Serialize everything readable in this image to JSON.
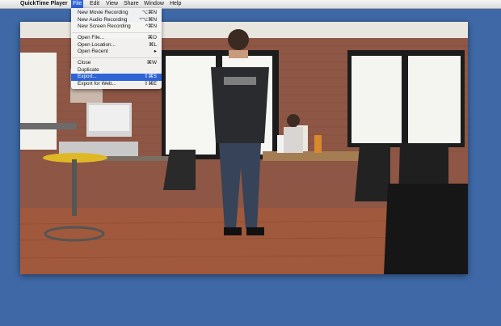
{
  "menubar": {
    "apple": "",
    "app_name": "QuickTime Player",
    "items": [
      "File",
      "Edit",
      "View",
      "Share",
      "Window",
      "Help"
    ]
  },
  "file_menu": {
    "items": [
      {
        "label": "New Movie Recording",
        "shortcut": "⌥⌘N"
      },
      {
        "label": "New Audio Recording",
        "shortcut": "^⌥⌘N"
      },
      {
        "label": "New Screen Recording",
        "shortcut": "^⌘N"
      },
      {
        "label": "Open File...",
        "shortcut": "⌘O"
      },
      {
        "label": "Open Location...",
        "shortcut": "⌘L"
      },
      {
        "label": "Open Recent",
        "shortcut": "▸"
      },
      {
        "label": "Close",
        "shortcut": "⌘W"
      },
      {
        "label": "Duplicate",
        "shortcut": ""
      },
      {
        "label": "Export...",
        "shortcut": "⇧⌘S"
      },
      {
        "label": "Export for Web...",
        "shortcut": "⇧⌘E"
      }
    ],
    "highlighted": "Export..."
  },
  "colors": {
    "desktop": "#3f69a6",
    "menu_highlight": "#2f64d6"
  }
}
